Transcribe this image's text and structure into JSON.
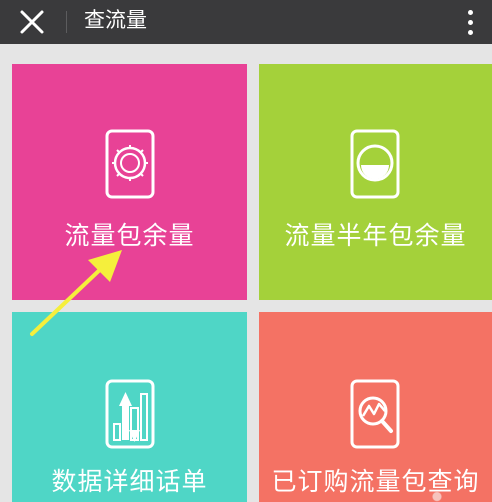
{
  "header": {
    "title": "查流量",
    "close_icon": "close-icon",
    "more_icon": "more-vertical-icon"
  },
  "tiles": [
    {
      "label": "流量包余量",
      "icon": "safe-dial-icon",
      "color": "#e84296"
    },
    {
      "label": "流量半年包余量",
      "icon": "half-gauge-icon",
      "color": "#a4d13a"
    },
    {
      "label": "数据详细话单",
      "icon": "bar-chart-arrows-icon",
      "color": "#4fd6c6"
    },
    {
      "label": "已订购流量包查询",
      "icon": "magnifier-chart-icon",
      "color": "#f47264"
    }
  ],
  "annotation": {
    "arrow_color": "#f5ef3c"
  }
}
